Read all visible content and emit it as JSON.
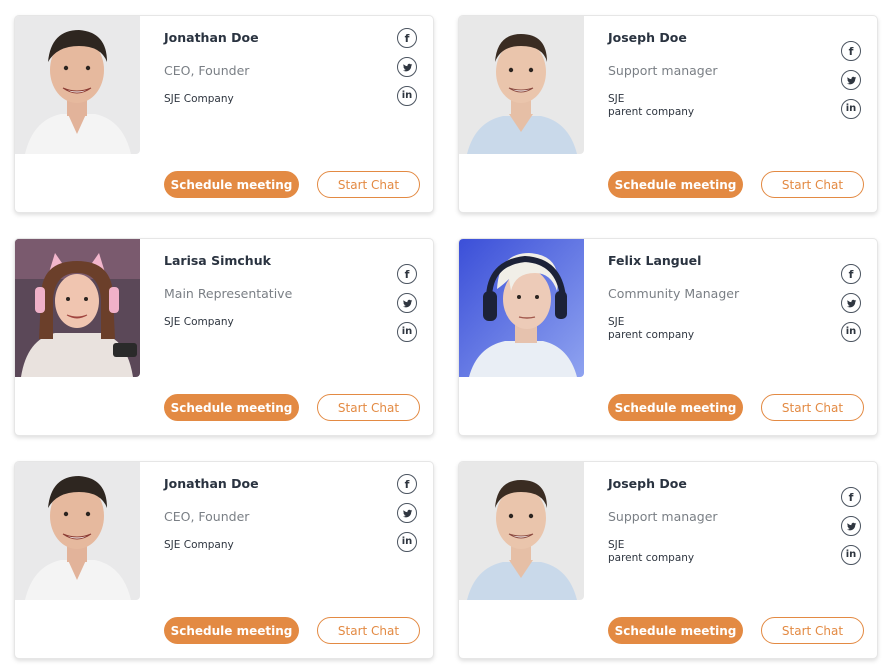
{
  "colors": {
    "accent": "#e38a43",
    "text_dark": "#2a3340",
    "text_muted": "#7a7f85"
  },
  "cards": [
    {
      "name": "Jonathan Doe",
      "title": "CEO, Founder",
      "company": [
        "SJE Company"
      ],
      "photo": "portrait-man-smiling-dark-hair",
      "schedule_label": "Schedule meeting",
      "chat_label": "Start Chat",
      "social": [
        "facebook-icon",
        "twitter-icon",
        "linkedin-icon"
      ]
    },
    {
      "name": "Joseph Doe",
      "title": "Support manager",
      "company": [
        "SJE",
        "parent company"
      ],
      "photo": "portrait-man-short-hair",
      "schedule_label": "Schedule meeting",
      "chat_label": "Start Chat",
      "social": [
        "facebook-icon",
        "twitter-icon",
        "linkedin-icon"
      ]
    },
    {
      "name": "Larisa Simchuk",
      "title": "Main Representative",
      "company": [
        "SJE Company"
      ],
      "photo": "portrait-woman-pink-cat-headset",
      "schedule_label": "Schedule meeting",
      "chat_label": "Start Chat",
      "social": [
        "facebook-icon",
        "twitter-icon",
        "linkedin-icon"
      ]
    },
    {
      "name": "Felix Languel",
      "title": "Community Manager",
      "company": [
        "SJE",
        "parent company"
      ],
      "photo": "portrait-man-blond-headphones",
      "schedule_label": "Schedule meeting",
      "chat_label": "Start Chat",
      "social": [
        "facebook-icon",
        "twitter-icon",
        "linkedin-icon"
      ]
    },
    {
      "name": "Jonathan Doe",
      "title": "CEO, Founder",
      "company": [
        "SJE Company"
      ],
      "photo": "portrait-man-smiling-dark-hair",
      "schedule_label": "Schedule meeting",
      "chat_label": "Start Chat",
      "social": [
        "facebook-icon",
        "twitter-icon",
        "linkedin-icon"
      ]
    },
    {
      "name": "Joseph Doe",
      "title": "Support manager",
      "company": [
        "SJE",
        "parent company"
      ],
      "photo": "portrait-man-short-hair",
      "schedule_label": "Schedule meeting",
      "chat_label": "Start Chat",
      "social": [
        "facebook-icon",
        "twitter-icon",
        "linkedin-icon"
      ]
    }
  ]
}
